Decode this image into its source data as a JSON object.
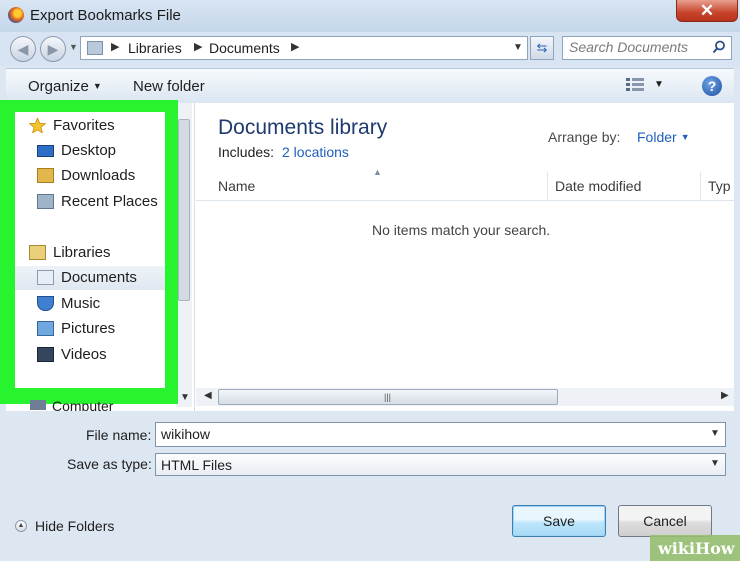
{
  "window": {
    "title": "Export Bookmarks File",
    "close_glyph": "✕"
  },
  "address": {
    "breadcrumbs": [
      "Libraries",
      "Documents"
    ],
    "search_placeholder": "Search Documents"
  },
  "toolbar": {
    "organize_label": "Organize",
    "new_folder_label": "New folder",
    "help_glyph": "?"
  },
  "sidebar": {
    "items": [
      {
        "label": "Favorites",
        "icon": "star-icon",
        "section": true
      },
      {
        "label": "Desktop",
        "icon": "desktop-icon"
      },
      {
        "label": "Downloads",
        "icon": "downloads-folder-icon"
      },
      {
        "label": "Recent Places",
        "icon": "recent-places-icon"
      },
      {
        "label": "Libraries",
        "icon": "libraries-icon",
        "section": true
      },
      {
        "label": "Documents",
        "icon": "documents-icon",
        "selected": true
      },
      {
        "label": "Music",
        "icon": "music-icon"
      },
      {
        "label": "Pictures",
        "icon": "pictures-icon"
      },
      {
        "label": "Videos",
        "icon": "videos-icon"
      }
    ],
    "computer_label": "Computer"
  },
  "content": {
    "title": "Documents library",
    "includes_label": "Includes:",
    "includes_link": "2 locations",
    "arrange_label": "Arrange by:",
    "arrange_value": "Folder",
    "columns": [
      "Name",
      "Date modified",
      "Typ"
    ],
    "empty_message": "No items match your search."
  },
  "form": {
    "file_name_label": "File name:",
    "file_name_value": "wikihow",
    "save_type_label": "Save as type:",
    "save_type_value": "HTML Files",
    "hide_folders_label": "Hide Folders",
    "save_label": "Save",
    "cancel_label": "Cancel"
  },
  "watermark": {
    "text": "wikiHow"
  },
  "colors": {
    "highlight": "#27f32e",
    "link": "#1f5fbf",
    "title": "#1e3a6e"
  }
}
